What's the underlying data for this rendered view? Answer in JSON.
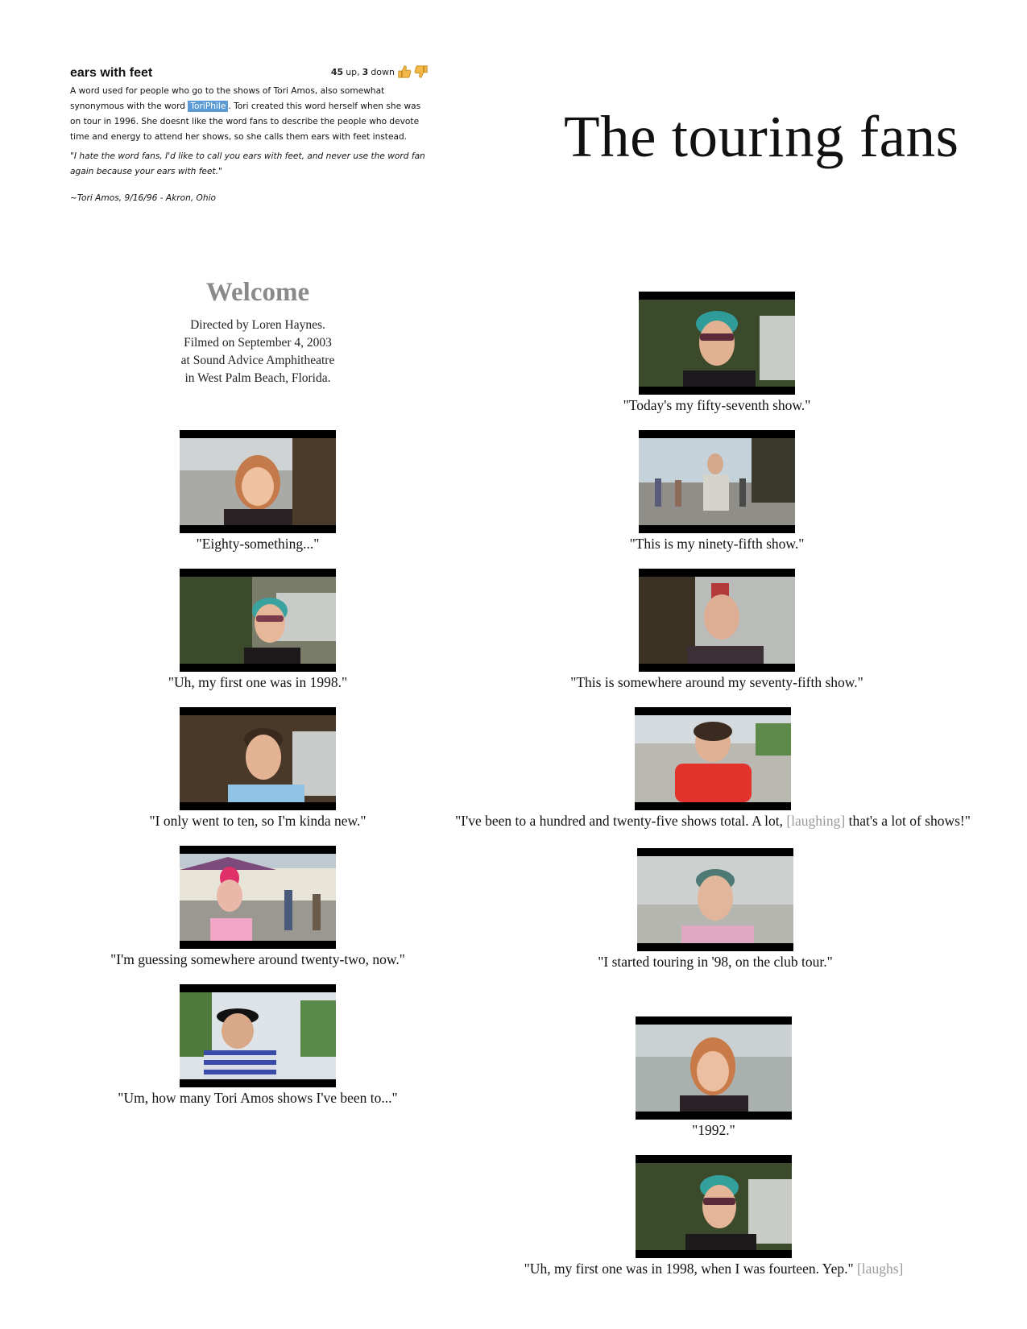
{
  "dictionary": {
    "term": "ears with feet",
    "votes": {
      "up_count": "45",
      "up_label": "up,",
      "down_count": "3",
      "down_label": "down"
    },
    "definition": {
      "before": "A word used for people who go to the shows of Tori Amos, also somewhat synonymous with the word ",
      "highlight": "ToriPhile",
      "after": ". Tori created this word herself when she was on tour in 1996. She doesnt like the word fans to describe the people who devote time and energy to attend her shows, so she calls them ears with feet instead."
    },
    "example": "\"I hate the word fans, I'd like to call you ears with feet, and never use the word fan again because your ears with feet.\"",
    "citation": "~Tori Amos, 9/16/96 - Akron, Ohio"
  },
  "title": "The touring fans",
  "welcome": {
    "heading": "Welcome",
    "lines": [
      "Directed by Loren Haynes.",
      "Filmed on September 4, 2003",
      "at Sound Advice Amphitheatre",
      "in West Palm Beach, Florida."
    ]
  },
  "clips": [
    {
      "caption": "\"Eighty-something...\""
    },
    {
      "caption": "\"Uh, my first one was in 1998.\""
    },
    {
      "caption": "\"I only went to ten, so I'm kinda new.\""
    },
    {
      "caption": "\"I'm guessing somewhere around twenty-two, now.\""
    },
    {
      "caption": "\"Um, how many Tori Amos shows I've been to...\""
    },
    {
      "caption": "\"Today's my fifty-seventh show.\""
    },
    {
      "caption": "\"This is my ninety-fifth show.\""
    },
    {
      "caption": "\"This is somewhere around my seventy-fifth show.\""
    },
    {
      "caption_before": "\"I've been to a hundred and twenty-five shows total. A lot, ",
      "aside": "[laughing]",
      "caption_after": " that's a lot of shows!\""
    },
    {
      "caption": "\"I started touring in '98, on the club tour.\""
    },
    {
      "caption": "\"1992.\""
    },
    {
      "caption_before": "\"Uh, my first one was in 1998, when I was fourteen. Yep.\" ",
      "aside": "[laughs]"
    }
  ],
  "colors": {
    "highlight": "#5b9bd5",
    "welcome_heading": "#8a8a8a",
    "aside_text": "#9a9a9a",
    "video_letterbox": "#000000"
  }
}
